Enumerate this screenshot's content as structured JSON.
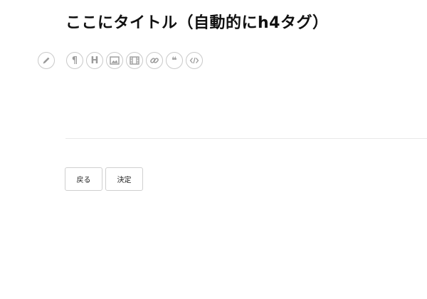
{
  "editor": {
    "title": "ここにタイトル（自動的にh4タグ）",
    "toolbar": [
      {
        "name": "paragraph-icon",
        "glyph": "¶"
      },
      {
        "name": "heading-icon",
        "glyph": "H"
      },
      {
        "name": "image-icon",
        "glyph": ""
      },
      {
        "name": "video-icon",
        "glyph": ""
      },
      {
        "name": "link-icon",
        "glyph": ""
      },
      {
        "name": "quote-icon",
        "glyph": "❝"
      },
      {
        "name": "code-icon",
        "glyph": ""
      }
    ],
    "content": ""
  },
  "actions": {
    "back_label": "戻る",
    "confirm_label": "決定"
  },
  "colors": {
    "icon": "#9a9a9a",
    "border": "#c9c9c9",
    "divider": "#e8e8e8"
  }
}
